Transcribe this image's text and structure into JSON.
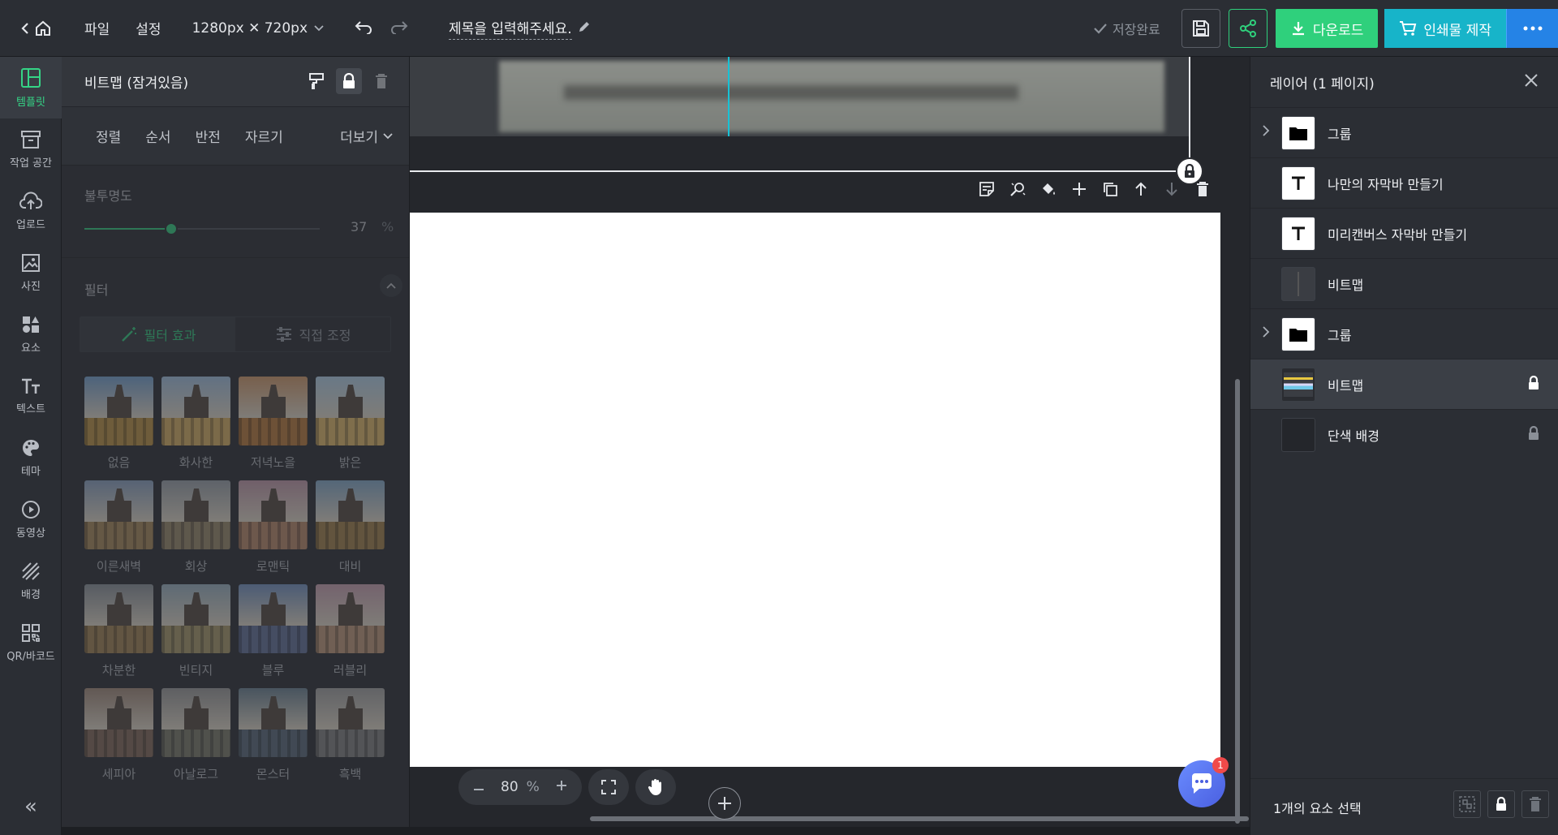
{
  "topbar": {
    "menu": [
      "파일",
      "설정"
    ],
    "size_label": "1280px ✕ 720px",
    "doc_title": "제목을 입력해주세요.",
    "saved_label": "저장완료",
    "download_label": "다운로드",
    "print_label": "인쇄물 제작"
  },
  "leftnav": {
    "items": [
      {
        "label": "템플릿",
        "icon": "template-icon"
      },
      {
        "label": "작업 공간",
        "icon": "workspace-icon"
      },
      {
        "label": "업로드",
        "icon": "upload-icon"
      },
      {
        "label": "사진",
        "icon": "photo-icon"
      },
      {
        "label": "요소",
        "icon": "elements-icon"
      },
      {
        "label": "텍스트",
        "icon": "text-icon"
      },
      {
        "label": "테마",
        "icon": "palette-icon"
      },
      {
        "label": "동영상",
        "icon": "video-icon"
      },
      {
        "label": "배경",
        "icon": "background-icon"
      },
      {
        "label": "QR/바코드",
        "icon": "qr-icon"
      }
    ]
  },
  "panel": {
    "title": "비트맵 (잠겨있음)",
    "tabs": [
      "정렬",
      "순서",
      "반전",
      "자르기"
    ],
    "more_label": "더보기",
    "opacity_label": "불투명도",
    "opacity_value": "37",
    "opacity_unit": "%",
    "opacity_fraction": 0.37,
    "filter_label": "필터",
    "filter_tabs": [
      "필터 효과",
      "직접 조정"
    ],
    "filters": [
      "없음",
      "화사한",
      "저녁노을",
      "밝은",
      "이른새벽",
      "회상",
      "로맨틱",
      "대비",
      "차분한",
      "빈티지",
      "블루",
      "러블리",
      "세피아",
      "아날로그",
      "몬스터",
      "흑백"
    ]
  },
  "canvas": {
    "zoom_value": "80",
    "zoom_unit": "%"
  },
  "chat_badge": "1",
  "layers": {
    "title": "레이어 (1 페이지)",
    "items": [
      {
        "name": "그룹",
        "type": "group",
        "locked": false
      },
      {
        "name": "나만의 자막바 만들기",
        "type": "text",
        "locked": false
      },
      {
        "name": "미리캔버스 자막바 만들기",
        "type": "text",
        "locked": false
      },
      {
        "name": "비트맵",
        "type": "bitmap-dark",
        "locked": false
      },
      {
        "name": "그룹",
        "type": "group",
        "locked": false
      },
      {
        "name": "비트맵",
        "type": "bitmap",
        "locked": true,
        "selected": true
      },
      {
        "name": "단색 배경",
        "type": "solid",
        "locked": true
      }
    ],
    "footer": "1개의 요소 선택"
  },
  "colors": {
    "accent_green": "#35d486",
    "download_green": "#2fd07c",
    "print_teal": "#17b4c9",
    "more_blue": "#2583e6"
  }
}
